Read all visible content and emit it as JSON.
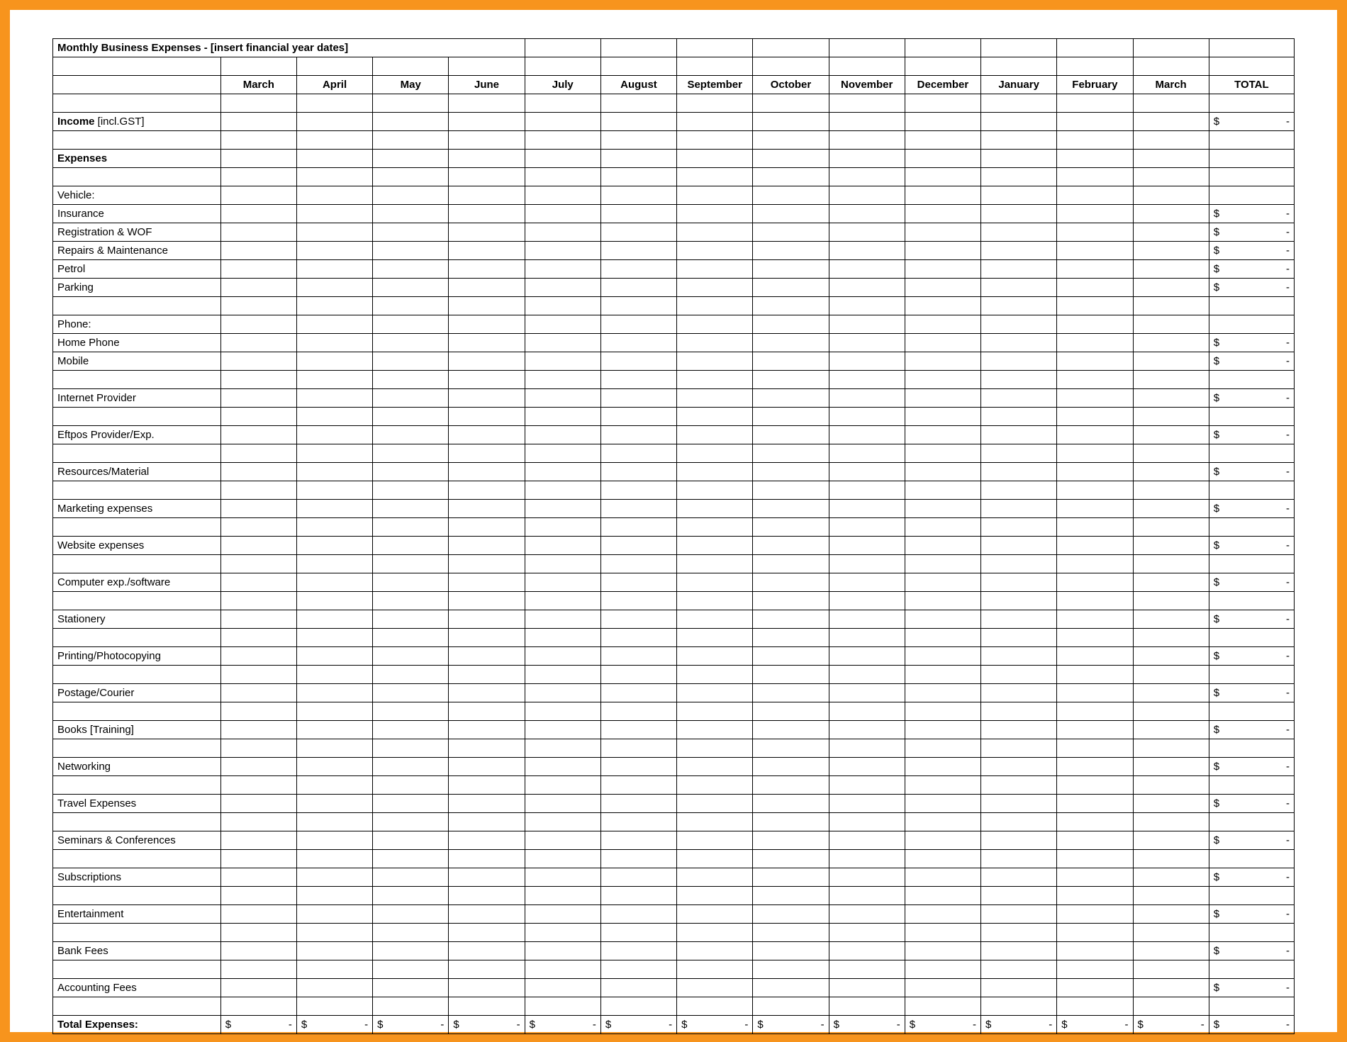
{
  "title": "Monthly Business Expenses - [insert financial year dates]",
  "currency": "$",
  "dash": "-",
  "columns": [
    "March",
    "April",
    "May",
    "June",
    "July",
    "August",
    "September",
    "October",
    "November",
    "December",
    "January",
    "February",
    "March",
    "TOTAL"
  ],
  "rows": [
    {
      "type": "title"
    },
    {
      "type": "blank"
    },
    {
      "type": "header-months"
    },
    {
      "type": "blank"
    },
    {
      "type": "label",
      "text": "Income [incl.GST]",
      "bold_prefix": "Income",
      "rest_text": " [incl.GST]",
      "total": true
    },
    {
      "type": "blank"
    },
    {
      "type": "label",
      "text": "Expenses",
      "bold": true
    },
    {
      "type": "blank"
    },
    {
      "type": "label",
      "text": "Vehicle:"
    },
    {
      "type": "label",
      "text": "Insurance",
      "indent": true,
      "total": true
    },
    {
      "type": "label",
      "text": "Registration & WOF",
      "indent": true,
      "total": true
    },
    {
      "type": "label",
      "text": "Repairs & Maintenance",
      "indent": true,
      "total": true
    },
    {
      "type": "label",
      "text": "Petrol",
      "indent": true,
      "total": true
    },
    {
      "type": "label",
      "text": "Parking",
      "indent": true,
      "total": true
    },
    {
      "type": "blank"
    },
    {
      "type": "label",
      "text": "Phone:"
    },
    {
      "type": "label",
      "text": "Home Phone",
      "indent": true,
      "total": true
    },
    {
      "type": "label",
      "text": "Mobile",
      "indent": true,
      "total": true
    },
    {
      "type": "blank"
    },
    {
      "type": "label",
      "text": "Internet Provider",
      "total": true
    },
    {
      "type": "blank"
    },
    {
      "type": "label",
      "text": "Eftpos Provider/Exp.",
      "total": true
    },
    {
      "type": "blank"
    },
    {
      "type": "label",
      "text": "Resources/Material",
      "total": true
    },
    {
      "type": "blank"
    },
    {
      "type": "label",
      "text": "Marketing expenses",
      "total": true
    },
    {
      "type": "blank"
    },
    {
      "type": "label",
      "text": "Website expenses",
      "total": true
    },
    {
      "type": "blank"
    },
    {
      "type": "label",
      "text": "Computer exp./software",
      "total": true
    },
    {
      "type": "blank"
    },
    {
      "type": "label",
      "text": "Stationery",
      "total": true
    },
    {
      "type": "blank"
    },
    {
      "type": "label",
      "text": "Printing/Photocopying",
      "total": true
    },
    {
      "type": "blank"
    },
    {
      "type": "label",
      "text": "Postage/Courier",
      "total": true
    },
    {
      "type": "blank"
    },
    {
      "type": "label",
      "text": "Books [Training]",
      "total": true
    },
    {
      "type": "blank"
    },
    {
      "type": "label",
      "text": "Networking",
      "total": true
    },
    {
      "type": "blank"
    },
    {
      "type": "label",
      "text": "Travel Expenses",
      "total": true
    },
    {
      "type": "blank"
    },
    {
      "type": "label",
      "text": "Seminars & Conferences",
      "total": true
    },
    {
      "type": "blank"
    },
    {
      "type": "label",
      "text": "Subscriptions",
      "total": true
    },
    {
      "type": "blank"
    },
    {
      "type": "label",
      "text": "Entertainment",
      "total": true
    },
    {
      "type": "blank"
    },
    {
      "type": "label",
      "text": "Bank Fees",
      "total": true
    },
    {
      "type": "blank"
    },
    {
      "type": "label",
      "text": "Accounting Fees",
      "total": true
    },
    {
      "type": "blank"
    },
    {
      "type": "label",
      "text": "Total Expenses:",
      "bold": true,
      "month_totals": true,
      "total": true
    }
  ]
}
